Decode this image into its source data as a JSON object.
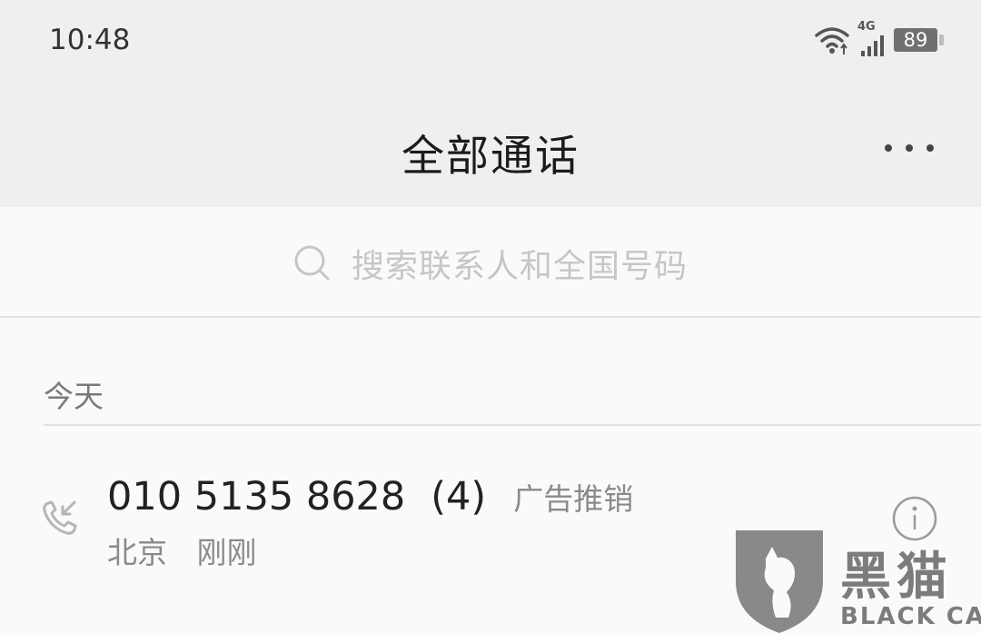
{
  "status_bar": {
    "time": "10:48",
    "network": "4G",
    "battery": "89",
    "icons": [
      "wifi-icon",
      "cellular-signal-icon",
      "battery-icon"
    ]
  },
  "header": {
    "title": "全部通话",
    "more_icon": "more-dots-icon"
  },
  "search": {
    "placeholder": "搜索联系人和全国号码",
    "icon": "search-icon"
  },
  "sections": [
    {
      "label": "今天",
      "calls": [
        {
          "number": "010 5135 8628",
          "count": "(4)",
          "tag": "广告推销",
          "location": "北京",
          "time": "刚刚",
          "icon": "incoming-call-icon",
          "info_icon": "info-icon"
        }
      ]
    }
  ],
  "watermark": {
    "text": "黑猫",
    "subtext": "BLACK CAT"
  },
  "colors": {
    "header_bg": "#efefef",
    "page_bg": "#fafafa",
    "primary_text": "#222222",
    "secondary_text": "#8a8a8a",
    "watermark": "#7c7c7c"
  }
}
